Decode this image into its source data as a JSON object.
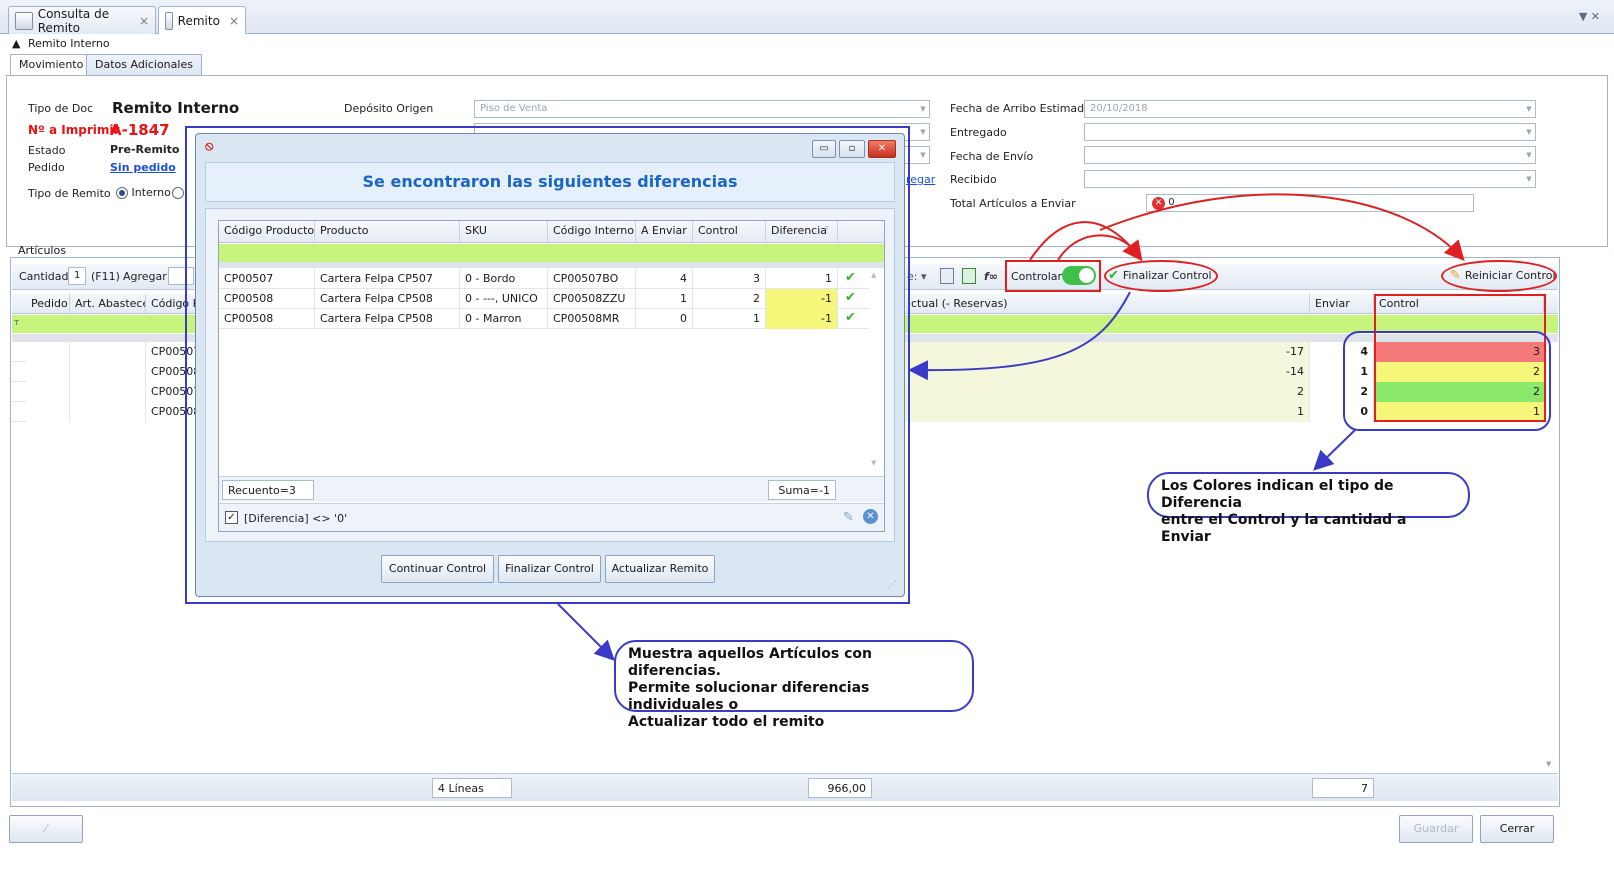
{
  "tabs": [
    {
      "label": "Consulta de Remito",
      "close": "×"
    },
    {
      "label": "Remito",
      "close": "×"
    }
  ],
  "header": {
    "group_title": "Remito Interno",
    "inner_tabs": [
      "Movimiento",
      "Datos Adicionales"
    ],
    "tipo_doc_label": "Tipo de Doc",
    "tipo_doc_value": "Remito Interno",
    "nro_label": "Nº a Imprimir",
    "nro_value": "A-1847",
    "estado_label": "Estado",
    "estado_value": "Pre-Remito",
    "pedido_label": "Pedido",
    "pedido_value": "Sin pedido",
    "tipo_remito_label": "Tipo de Remito",
    "tipo_remito_option1": "Interno",
    "deposito_origen_label": "Depósito Origen",
    "deposito_origen_value": "Piso de Venta",
    "agregar_link": "regar",
    "fecha_arribo_label": "Fecha de Arribo Estimada",
    "fecha_arribo_value": "20/10/2018",
    "entregado_label": "Entregado",
    "fecha_envio_label": "Fecha de Envío",
    "recibido_label": "Recibido",
    "total_label": "Total Artículos a Enviar",
    "total_value": "0"
  },
  "articulos": {
    "group_title": "Artículos",
    "cantidad_label": "Cantidad",
    "cantidad_value": "1",
    "shortcut": "(F11)",
    "agregar_label": "Agregar",
    "controlar_label": "Controlar",
    "finalizar_label": "Finalizar Control",
    "reiniciar_label": "Reiniciar Control",
    "columns": {
      "pedido": "Pedido",
      "art_abastece": "Art. Abastece",
      "codigo": "Código P",
      "stock": "ctual (- Reservas)",
      "enviar": "Enviar",
      "control": "Control"
    },
    "rows": [
      {
        "codigo": "CP00507",
        "stock": "-17",
        "enviar": "4",
        "control": "3",
        "color": "#f47a7a"
      },
      {
        "codigo": "CP00508",
        "stock": "-14",
        "enviar": "1",
        "control": "2",
        "color": "#f6f67a"
      },
      {
        "codigo": "CP00507",
        "stock": "2",
        "enviar": "2",
        "control": "2",
        "color": "#8ae86a"
      },
      {
        "codigo": "CP00508",
        "stock": "1",
        "enviar": "0",
        "control": "1",
        "color": "#f6f67a"
      }
    ],
    "footer_lineas": "4 Líneas",
    "footer_total": "966,00",
    "footer_enviar": "7"
  },
  "buttons": {
    "guardar": "Guardar",
    "cerrar": "Cerrar"
  },
  "dialog": {
    "title": "Se encontraron las siguientes diferencias",
    "columns": [
      "Código Producto",
      "Producto",
      "SKU",
      "Código Interno",
      "A Enviar",
      "Control",
      "Diferencia"
    ],
    "rows": [
      {
        "codigo": "CP00507",
        "producto": "Cartera Felpa CP507",
        "sku": "0 - Bordo",
        "interno": "CP00507BO",
        "enviar": "4",
        "control": "3",
        "diferencia": "1",
        "highlight": false
      },
      {
        "codigo": "CP00508",
        "producto": "Cartera Felpa CP508",
        "sku": "0 - ---, UNICO",
        "interno": "CP00508ZZU",
        "enviar": "1",
        "control": "2",
        "diferencia": "-1",
        "highlight": true
      },
      {
        "codigo": "CP00508",
        "producto": "Cartera Felpa CP508",
        "sku": "0 - Marron",
        "interno": "CP00508MR",
        "enviar": "0",
        "control": "1",
        "diferencia": "-1",
        "highlight": true
      }
    ],
    "recuento": "Recuento=3",
    "suma": "Suma=-1",
    "filter_text": "[Diferencia] <> '0'",
    "btn_continuar": "Continuar Control",
    "btn_finalizar": "Finalizar Control",
    "btn_actualizar": "Actualizar Remito"
  },
  "annotations": {
    "callout_dialog": [
      "Muestra aquellos Artículos con diferencias.",
      "Permite solucionar diferencias individuales o",
      "Actualizar todo el remito"
    ],
    "callout_colors": [
      "Los Colores indican el tipo de Diferencia",
      "entre el Control y la cantidad a Enviar"
    ]
  },
  "colors": {
    "accent_blue": "#1a66c8",
    "annotation_red": "#e02020",
    "annotation_blue": "#3a3ac8",
    "filter_green": "#c6f47c"
  }
}
